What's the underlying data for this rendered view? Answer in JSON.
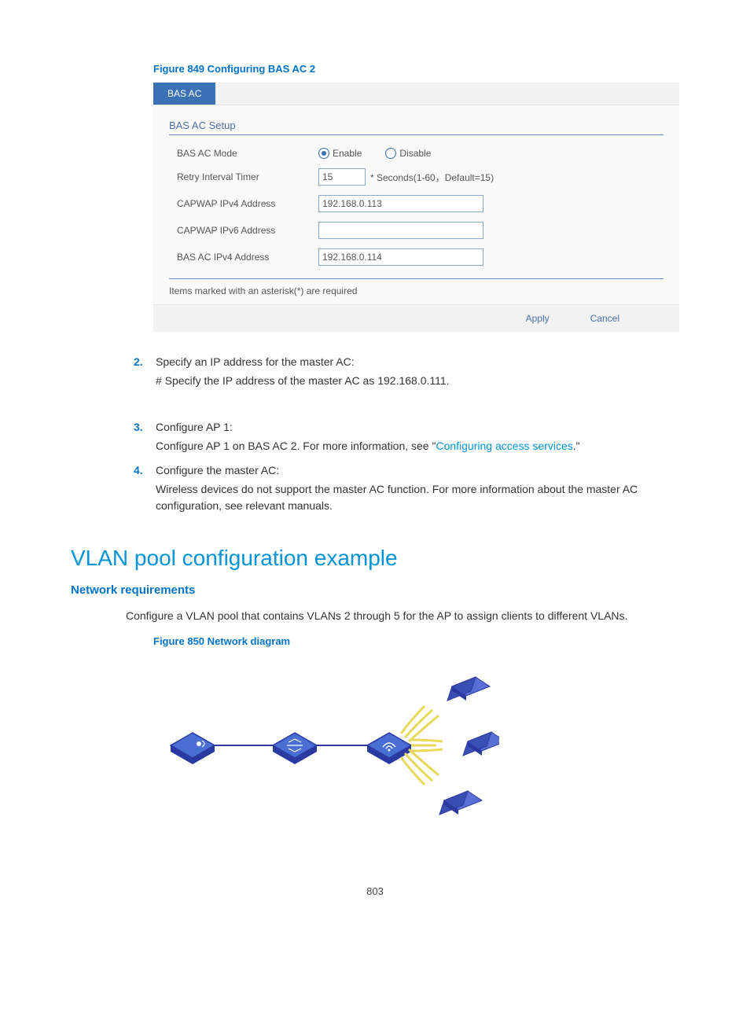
{
  "figure1_title": "Figure 849 Configuring BAS AC 2",
  "tab_label": "BAS AC",
  "section_head": "BAS AC Setup",
  "rows": {
    "mode_label": "BAS AC Mode",
    "enable": "Enable",
    "disable": "Disable",
    "retry_label": "Retry Interval Timer",
    "retry_value": "15",
    "retry_hint": "* Seconds(1-60，Default=15)",
    "capwap4_label": "CAPWAP IPv4 Address",
    "capwap4_value": "192.168.0.113",
    "capwap6_label": "CAPWAP IPv6 Address",
    "capwap6_value": "",
    "bas4_label": "BAS AC IPv4 Address",
    "bas4_value": "192.168.0.114"
  },
  "note": "Items marked with an asterisk(*) are required",
  "apply": "Apply",
  "cancel": "Cancel",
  "steps": {
    "s2_title": "Specify an IP address for the master AC:",
    "s2_body": "# Specify the IP address of the master AC as 192.168.0.111.",
    "s3_title": "Configure AP 1:",
    "s3_body_pre": "Configure AP 1 on BAS AC 2. For more information, see \"",
    "s3_link": "Configuring access services",
    "s3_body_post": ".\"",
    "s4_title": "Configure the master AC:",
    "s4_body": "Wireless devices do not support the master AC function. For more information about the master AC configuration, see relevant manuals."
  },
  "h2": "VLAN pool configuration example",
  "h3": "Network requirements",
  "para": "Configure a VLAN pool that contains VLANs 2 through 5 for the AP to assign clients to different VLANs.",
  "figure2_title": "Figure 850 Network diagram",
  "pagenum": "803"
}
